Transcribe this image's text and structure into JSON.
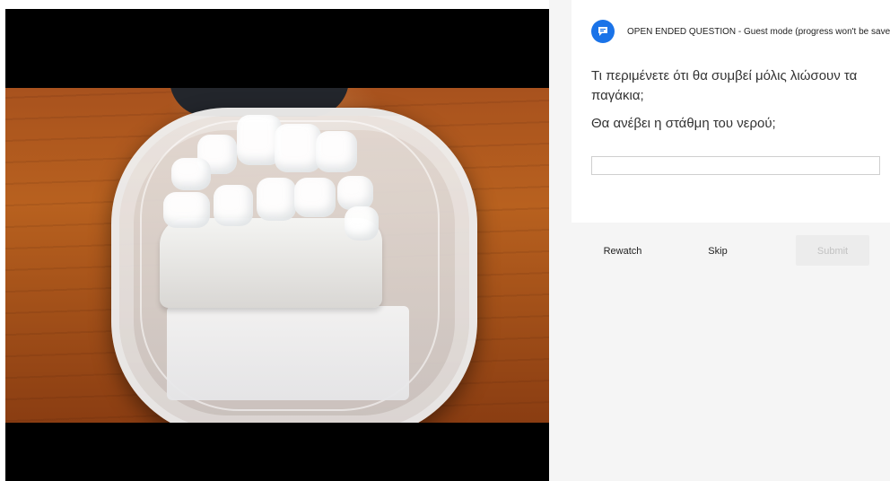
{
  "question": {
    "header_type": "OPEN ENDED QUESTION",
    "header_mode": " - Guest mode (progress won't be saved)",
    "line1": "Τι περιμένετε ότι θα συμβεί μόλις λιώσουν τα παγάκια;",
    "line2": "Θα ανέβει η στάθμη του νερού;",
    "answer_value": ""
  },
  "actions": {
    "rewatch": "Rewatch",
    "skip": "Skip",
    "submit": "Submit"
  },
  "colors": {
    "accent": "#1a73e8",
    "panel_bg": "#f5f5f5"
  },
  "icons": {
    "question_icon": "chat-bubble-icon"
  }
}
